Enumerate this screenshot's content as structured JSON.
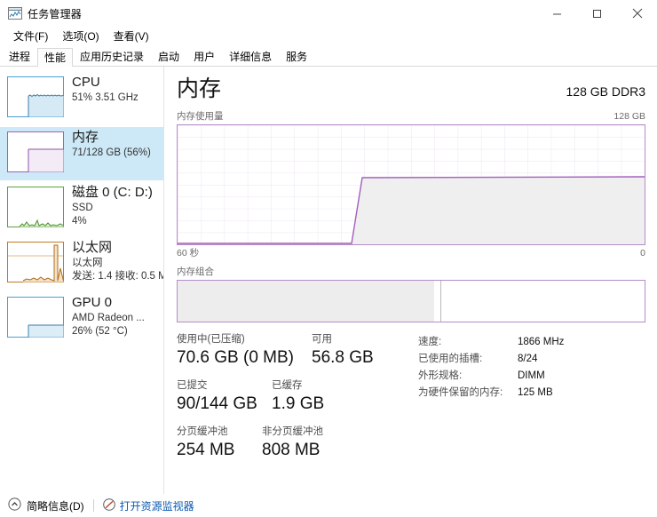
{
  "window": {
    "title": "任务管理器",
    "icon": "task-manager-icon",
    "minimize_label": "最小化",
    "maximize_label": "最大化",
    "close_label": "关闭"
  },
  "menubar": {
    "items": [
      {
        "label": "文件(F)"
      },
      {
        "label": "选项(O)"
      },
      {
        "label": "查看(V)"
      }
    ]
  },
  "tabs": {
    "items": [
      {
        "label": "进程",
        "selected": false
      },
      {
        "label": "性能",
        "selected": true
      },
      {
        "label": "应用历史记录",
        "selected": false
      },
      {
        "label": "启动",
        "selected": false
      },
      {
        "label": "用户",
        "selected": false
      },
      {
        "label": "详细信息",
        "selected": false
      },
      {
        "label": "服务",
        "selected": false
      }
    ]
  },
  "sidebar": {
    "items": [
      {
        "name": "cpu",
        "title": "CPU",
        "line1": "51% 3.51 GHz",
        "line2": "",
        "selected": false,
        "color": "#4a9fd0",
        "fill": "#d6eaf6",
        "level_pct": 51,
        "thumb_style": "jagged"
      },
      {
        "name": "memory",
        "title": "内存",
        "line1": "71/128 GB (56%)",
        "line2": "",
        "selected": true,
        "color": "#a35fbd",
        "fill": "#f2e9f6",
        "level_pct": 56,
        "thumb_style": "step"
      },
      {
        "name": "disk-0",
        "title": "磁盘 0 (C: D:)",
        "line1": "SSD",
        "line2": "4%",
        "selected": false,
        "color": "#5ca13b",
        "fill": "#e4f2dc",
        "level_pct": 4,
        "thumb_style": "spikes"
      },
      {
        "name": "ethernet",
        "title": "以太网",
        "line1": "以太网",
        "line2": "发送: 1.4 接收: 0.5 M",
        "selected": false,
        "color": "#c07a22",
        "fill": "#f6e8d2",
        "level_pct": 10,
        "thumb_style": "net"
      },
      {
        "name": "gpu-0",
        "title": "GPU 0",
        "line1": "AMD Radeon ...",
        "line2": "26% (52 °C)",
        "selected": false,
        "color": "#4a9fd0",
        "fill": "#dceef8",
        "level_pct": 26,
        "thumb_style": "step"
      }
    ]
  },
  "detail": {
    "title": "内存",
    "subtitle": "128 GB DDR3",
    "usage_chart": {
      "caption": "内存使用量",
      "max_label": "128 GB",
      "time_label": "60 秒",
      "min_label": "0"
    },
    "composition": {
      "caption": "内存组合",
      "in_use_pct": 55,
      "divider_pct": 56.3
    },
    "stats": [
      {
        "label": "使用中(已压缩)",
        "value": "70.6 GB (0 MB)"
      },
      {
        "label": "可用",
        "value": "56.8 GB"
      },
      {
        "label": "已提交",
        "value": "90/144 GB"
      },
      {
        "label": "已缓存",
        "value": "1.9 GB"
      },
      {
        "label": "分页缓冲池",
        "value": "254 MB"
      },
      {
        "label": "非分页缓冲池",
        "value": "808 MB"
      }
    ],
    "info": [
      {
        "key": "速度:",
        "value": "1866 MHz"
      },
      {
        "key": "已使用的插槽:",
        "value": "8/24"
      },
      {
        "key": "外形规格:",
        "value": "DIMM"
      },
      {
        "key": "为硬件保留的内存:",
        "value": "125 MB"
      }
    ]
  },
  "statusbar": {
    "fewer_details": "简略信息(D)",
    "resource_monitor": "打开资源监视器"
  },
  "chart_data": {
    "type": "area",
    "title": "内存使用量",
    "xlabel": "60 秒",
    "ylabel": "",
    "ylim": [
      0,
      128
    ],
    "y_unit": "GB",
    "y_max_label": "128 GB",
    "y_min_label": "0",
    "x": [
      0,
      5,
      10,
      15,
      20,
      25,
      30,
      33,
      34,
      35,
      40,
      45,
      50,
      55,
      60
    ],
    "values": [
      0,
      0,
      0,
      0,
      0,
      0,
      0,
      0,
      36,
      71,
      71,
      71,
      71,
      71,
      71
    ],
    "line_color": "#a35fbd",
    "fill_color": "#efefef",
    "grid": true,
    "grid_cols": 20,
    "grid_rows": 10
  }
}
